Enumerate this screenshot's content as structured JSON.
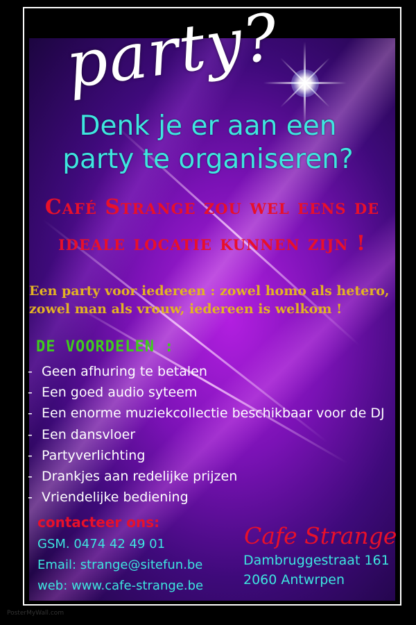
{
  "poster": {
    "party_word": "party?",
    "headline_line1": "Denk je er aan een",
    "headline_line2": "party te organiseren?",
    "pitch_line1": "Café Strange zou wel eens de",
    "pitch_line2": "ideale locatie kunnen zijn !",
    "welcome_line1": "Een party voor iedereen : zowel homo als hetero,",
    "welcome_line2": "zowel man als vrouw, iedereen is welkom !",
    "voordelen_title": "DE VOORDELEN :",
    "benefits": [
      "Geen afhuring te betalen",
      "Een goed audio syteem",
      "Een enorme muziekcollectie beschikbaar voor de DJ",
      "Een dansvloer",
      "Partyverlichting",
      "Drankjes aan redelijke prijzen",
      "Vriendelijke bediening"
    ],
    "contact_title": "contacteer ons:",
    "contact_gsm": "GSM.  0474 42 49 01",
    "contact_email": "Email: strange@sitefun.be",
    "contact_web": "web: www.cafe-strange.be",
    "cafe_name": "Cafe Strange",
    "address_line1": "Dambruggestraat 161",
    "address_line2": "2060 Antwrpen",
    "watermark": "PosterMyWall.com"
  },
  "colors": {
    "headline": "#3ee6e0",
    "accent_red": "#e8102a",
    "welcome_gold": "#e3b323",
    "voordelen_green": "#3fcc1c",
    "background": "#7a12b5"
  }
}
